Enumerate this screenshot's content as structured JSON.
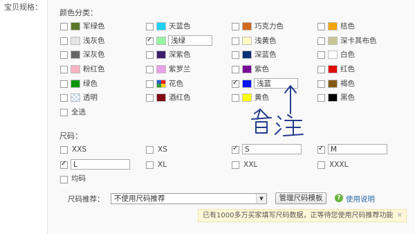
{
  "spec_label": "宝贝规格：",
  "color_section": {
    "title": "颜色分类：",
    "rows": [
      [
        {
          "label": "军绿色",
          "color": "#5d762a",
          "checked": false
        },
        {
          "label": "天蓝色",
          "color": "#1ed1f5",
          "checked": false
        },
        {
          "label": "巧克力色",
          "color": "#d2691e",
          "checked": false
        },
        {
          "label": "桔色",
          "color": "#f5a50a",
          "checked": false
        }
      ],
      [
        {
          "label": "浅灰色",
          "color": "#e4e4e4",
          "checked": false
        },
        {
          "label": "浅绿",
          "color": "#96f5a0",
          "checked": true,
          "input": "浅绿"
        },
        {
          "label": "浅黄色",
          "color": "#fdfdc3",
          "checked": false
        },
        {
          "label": "深卡其布色",
          "color": "#c8c696",
          "checked": false
        }
      ],
      [
        {
          "label": "深灰色",
          "color": "#666666",
          "checked": false
        },
        {
          "label": "深紫色",
          "color": "#3c1e6e",
          "checked": false
        },
        {
          "label": "深蓝色",
          "color": "#0a3278",
          "checked": false
        },
        {
          "label": "白色",
          "color": "#ffffff",
          "checked": false
        }
      ],
      [
        {
          "label": "粉红色",
          "color": "#fab4c3",
          "checked": false
        },
        {
          "label": "紫罗兰",
          "color": "#e6a0e6",
          "checked": false
        },
        {
          "label": "紫色",
          "color": "#780a96",
          "checked": false
        },
        {
          "label": "红色",
          "color": "#e10a0a",
          "checked": false
        }
      ],
      [
        {
          "label": "绿色",
          "color": "#0a960a",
          "checked": false
        },
        {
          "label": "花色",
          "color": "pattern-flower",
          "checked": false
        },
        {
          "label": "浅蓝",
          "color": "#0a14f0",
          "checked": true,
          "input": "浅蓝"
        },
        {
          "label": "褐色",
          "color": "#825a14",
          "checked": false
        }
      ],
      [
        {
          "label": "透明",
          "color": "pattern-transparent",
          "checked": false
        },
        {
          "label": "酒红色",
          "color": "#820a14",
          "checked": false
        },
        {
          "label": "黄色",
          "color": "#ffff0a",
          "checked": false
        },
        {
          "label": "黑色",
          "color": "#000000",
          "checked": false
        }
      ]
    ],
    "select_all": "全选"
  },
  "size_section": {
    "title": "尺码：",
    "rows": [
      [
        {
          "label": "XXS",
          "checked": false
        },
        {
          "label": "XS",
          "checked": false
        },
        {
          "label": "S",
          "checked": true,
          "input": "S"
        },
        {
          "label": "M",
          "checked": true,
          "input": "M"
        }
      ],
      [
        {
          "label": "L",
          "checked": true,
          "input": "L"
        },
        {
          "label": "XL",
          "checked": false
        },
        {
          "label": "XXL",
          "checked": false
        },
        {
          "label": "XXXL",
          "checked": false
        }
      ]
    ],
    "uniform": "均码"
  },
  "recommend": {
    "label": "尺码推荐：",
    "selected": "不使用尺码推荐",
    "manage_button": "管理尺码模板",
    "help_link": "使用说明",
    "help_icon": "question-icon"
  },
  "notice": {
    "text": "已有1000多万买家填写尺码数据，正等待您使用尺码推荐功能",
    "close_glyph": "✕"
  },
  "annotation": {
    "text": "备注",
    "ink_color": "#233c8c",
    "icon": "up-arrow-handwritten"
  }
}
